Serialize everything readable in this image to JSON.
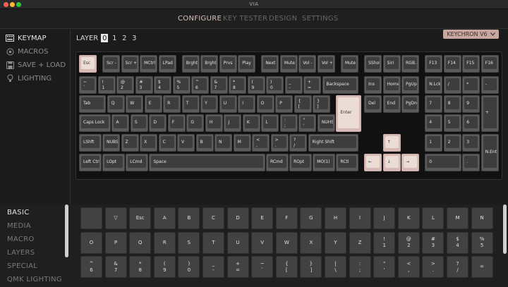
{
  "window": {
    "title": "VIA"
  },
  "nav": {
    "tabs": [
      "CONFIGURE",
      "KEY TESTER",
      "DESIGN",
      "SETTINGS"
    ],
    "active": 0
  },
  "sidebar": {
    "items": [
      {
        "label": "KEYMAP",
        "icon": "keyboard-icon",
        "active": true
      },
      {
        "label": "MACROS",
        "icon": "circle-dot-icon",
        "active": false
      },
      {
        "label": "SAVE + LOAD",
        "icon": "save-icon",
        "active": false
      },
      {
        "label": "LIGHTING",
        "icon": "bulb-icon",
        "active": false
      }
    ]
  },
  "layers": {
    "label": "LAYER",
    "options": [
      "0",
      "1",
      "2",
      "3"
    ],
    "active": 0
  },
  "keyboard_select": {
    "value": "KEYCHRON V6",
    "icon": "chevron-down-icon"
  },
  "keyboard_keys": [
    "Esc",
    "Scr -",
    "Scr +",
    "MCtrl",
    "LPad",
    "Brght-",
    "Brght+",
    "Prvs",
    "Play",
    "Next",
    "Mute",
    "Vol -",
    "Vol +",
    "Mute",
    "SShot",
    "Siri",
    "RGB...",
    "F13",
    "F14",
    "F15",
    "F16",
    "~\n`",
    "!\n1",
    "@\n2",
    "#\n3",
    "$\n4",
    "%\n5",
    "^\n6",
    "&\n7",
    "*\n8",
    "(\n9",
    ")\n0",
    "_\n-",
    "+\n=",
    "Backspace",
    "Ins",
    "Home",
    "PgUp",
    "N.Lck",
    "/",
    "*",
    "-",
    "Tab",
    "Q",
    "W",
    "E",
    "R",
    "T",
    "Y",
    "U",
    "I",
    "O",
    "P",
    "{\n[",
    "}\n]",
    "Enter",
    "Del",
    "End",
    "PgDn",
    "7",
    "8",
    "9",
    "+",
    "Caps Lock",
    "A",
    "S",
    "D",
    "F",
    "G",
    "H",
    "J",
    "K",
    "L",
    ":\n;",
    "\"\n'",
    "NUHS",
    "4",
    "5",
    "6",
    "LShft",
    "NUBS",
    "Z",
    "X",
    "C",
    "V",
    "B",
    "N",
    "M",
    "<\n,",
    ">\n.",
    "?\n/",
    "Right Shift",
    "↑",
    "1",
    "2",
    "3",
    "N.Ent",
    "Left Ctrl",
    "LOpt",
    "LCmd",
    "Space",
    "RCmd",
    "ROpt",
    "MO(1)",
    "RCtl",
    "←",
    "↓",
    "→",
    "0",
    "."
  ],
  "bottom": {
    "categories": [
      "BASIC",
      "MEDIA",
      "MACRO",
      "LAYERS",
      "SPECIAL",
      "QMK LIGHTING"
    ],
    "active": 0,
    "keys": [
      "",
      "▽",
      "Esc",
      "A",
      "B",
      "C",
      "D",
      "E",
      "F",
      "G",
      "H",
      "I",
      "J",
      "K",
      "L",
      "M",
      "N",
      "O",
      "P",
      "Q",
      "R",
      "S",
      "T",
      "U",
      "V",
      "W",
      "X",
      "Y",
      "Z",
      "!\n1",
      "@\n2",
      "#\n3",
      "$\n4",
      "%\n5",
      "^\n6",
      "&\n7",
      "*\n8",
      "(\n9",
      ")\n0",
      "_\n-",
      "+\n=",
      "~\n`",
      "{\n[",
      "}\n]",
      "|\n\\",
      ":\n;",
      "\"\n'",
      "<\n,",
      ">\n.",
      "?\n/",
      "="
    ]
  }
}
